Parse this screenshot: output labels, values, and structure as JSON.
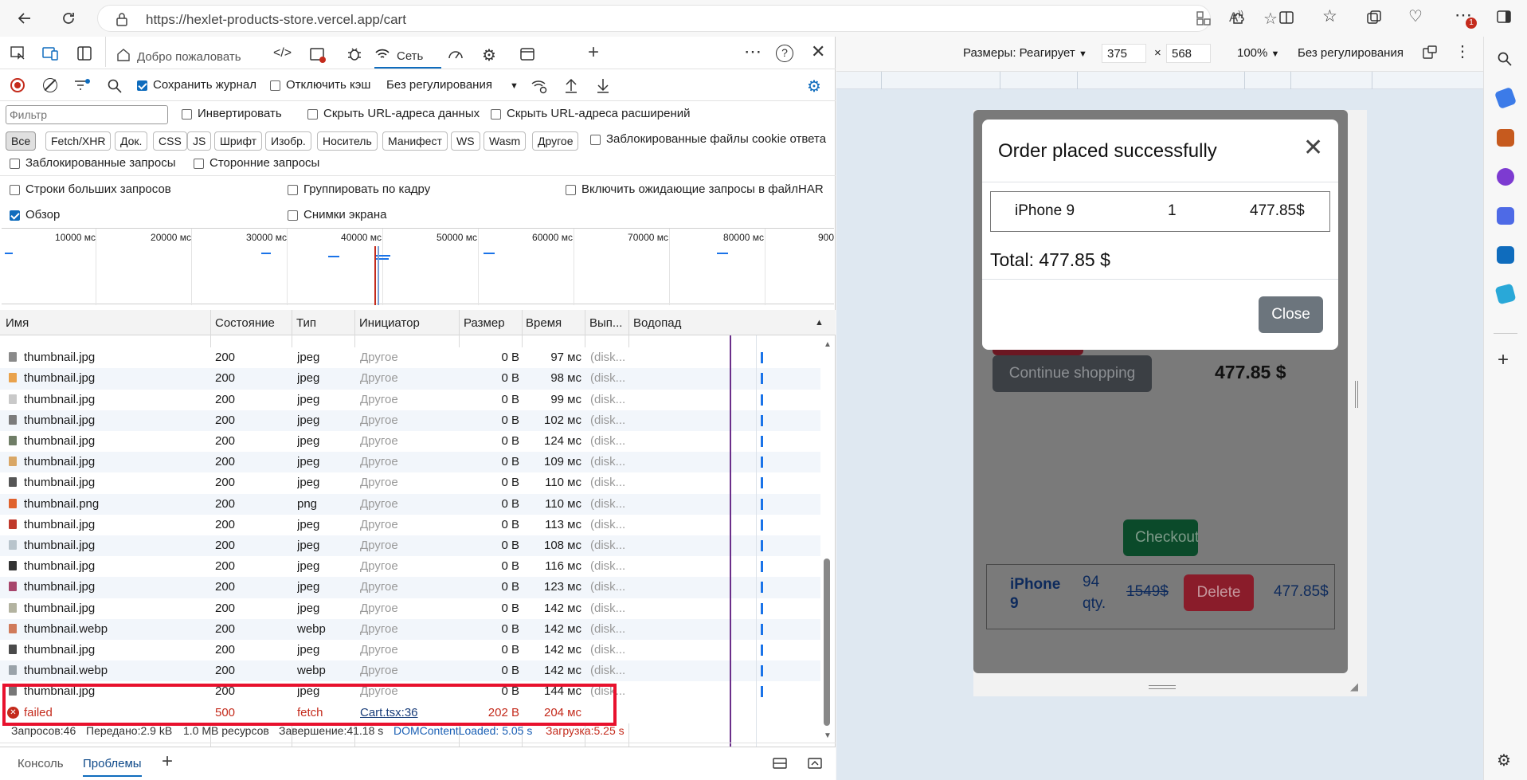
{
  "browser": {
    "url": "https://hexlet-products-store.vercel.app/cart"
  },
  "devtools": {
    "tabs": {
      "welcome": "Добро пожаловать",
      "network": "Сеть"
    },
    "toolbar": {
      "preserve_log": "Сохранить журнал",
      "disable_cache": "Отключить кэш",
      "throttling": "Без регулирования"
    },
    "filter": {
      "placeholder": "Фильтр",
      "invert": "Инвертировать",
      "hide_data_urls": "Скрыть URL-адреса данных",
      "hide_ext_urls": "Скрыть URL-адреса расширений",
      "blocked_cookies": "Заблокированные файлы cookie ответа",
      "blocked_requests": "Заблокированные запросы",
      "third_party": "Сторонние запросы"
    },
    "type_chips": [
      "Все",
      "Fetch/XHR",
      "Док.",
      "CSS",
      "JS",
      "Шрифт",
      "Изобр.",
      "Носитель",
      "Манифест",
      "WS",
      "Wasm",
      "Другое"
    ],
    "options": {
      "big_rows": "Строки больших запросов",
      "group_by_frame": "Группировать по кадру",
      "include_pending": "Включить ожидающие запросы в файлHAR",
      "overview": "Обзор",
      "screenshots": "Снимки экрана"
    },
    "overview_ticks": [
      "10000 мс",
      "20000 мс",
      "30000 мс",
      "40000 мс",
      "50000 мс",
      "60000 мс",
      "70000 мс",
      "80000 мс",
      "900"
    ],
    "columns": [
      "Имя",
      "Состояние",
      "Тип",
      "Инициатор",
      "Размер",
      "Время",
      "Вып...",
      "Водопад"
    ],
    "rows": [
      {
        "name": "thumbnail.jpg",
        "status": "200",
        "type": "jpeg",
        "initiator": "Другое",
        "size": "0 B",
        "time": "97 мс",
        "fulfilled": "(disk...",
        "icon_color": "#8a8a8a"
      },
      {
        "name": "thumbnail.jpg",
        "status": "200",
        "type": "jpeg",
        "initiator": "Другое",
        "size": "0 B",
        "time": "98 мс",
        "fulfilled": "(disk...",
        "icon_color": "#e9a24c"
      },
      {
        "name": "thumbnail.jpg",
        "status": "200",
        "type": "jpeg",
        "initiator": "Другое",
        "size": "0 B",
        "time": "99 мс",
        "fulfilled": "(disk...",
        "icon_color": "#c9c9c9"
      },
      {
        "name": "thumbnail.jpg",
        "status": "200",
        "type": "jpeg",
        "initiator": "Другое",
        "size": "0 B",
        "time": "102 мс",
        "fulfilled": "(disk...",
        "icon_color": "#7c7c7c"
      },
      {
        "name": "thumbnail.jpg",
        "status": "200",
        "type": "jpeg",
        "initiator": "Другое",
        "size": "0 B",
        "time": "124 мс",
        "fulfilled": "(disk...",
        "icon_color": "#6f7d66"
      },
      {
        "name": "thumbnail.jpg",
        "status": "200",
        "type": "jpeg",
        "initiator": "Другое",
        "size": "0 B",
        "time": "109 мс",
        "fulfilled": "(disk...",
        "icon_color": "#d9a766"
      },
      {
        "name": "thumbnail.jpg",
        "status": "200",
        "type": "jpeg",
        "initiator": "Другое",
        "size": "0 B",
        "time": "110 мс",
        "fulfilled": "(disk...",
        "icon_color": "#555555"
      },
      {
        "name": "thumbnail.png",
        "status": "200",
        "type": "png",
        "initiator": "Другое",
        "size": "0 B",
        "time": "110 мс",
        "fulfilled": "(disk...",
        "icon_color": "#e0622d"
      },
      {
        "name": "thumbnail.jpg",
        "status": "200",
        "type": "jpeg",
        "initiator": "Другое",
        "size": "0 B",
        "time": "113 мс",
        "fulfilled": "(disk...",
        "icon_color": "#c0392b"
      },
      {
        "name": "thumbnail.jpg",
        "status": "200",
        "type": "jpeg",
        "initiator": "Другое",
        "size": "0 B",
        "time": "108 мс",
        "fulfilled": "(disk...",
        "icon_color": "#b8c4cc"
      },
      {
        "name": "thumbnail.jpg",
        "status": "200",
        "type": "jpeg",
        "initiator": "Другое",
        "size": "0 B",
        "time": "116 мс",
        "fulfilled": "(disk...",
        "icon_color": "#333333"
      },
      {
        "name": "thumbnail.jpg",
        "status": "200",
        "type": "jpeg",
        "initiator": "Другое",
        "size": "0 B",
        "time": "123 мс",
        "fulfilled": "(disk...",
        "icon_color": "#a7456b"
      },
      {
        "name": "thumbnail.jpg",
        "status": "200",
        "type": "jpeg",
        "initiator": "Другое",
        "size": "0 B",
        "time": "142 мс",
        "fulfilled": "(disk...",
        "icon_color": "#b3b3a0"
      },
      {
        "name": "thumbnail.webp",
        "status": "200",
        "type": "webp",
        "initiator": "Другое",
        "size": "0 B",
        "time": "142 мс",
        "fulfilled": "(disk...",
        "icon_color": "#d07a5a"
      },
      {
        "name": "thumbnail.jpg",
        "status": "200",
        "type": "jpeg",
        "initiator": "Другое",
        "size": "0 B",
        "time": "142 мс",
        "fulfilled": "(disk...",
        "icon_color": "#4a4a4a"
      },
      {
        "name": "thumbnail.webp",
        "status": "200",
        "type": "webp",
        "initiator": "Другое",
        "size": "0 B",
        "time": "142 мс",
        "fulfilled": "(disk...",
        "icon_color": "#9aa3aa"
      },
      {
        "name": "thumbnail.jpg",
        "status": "200",
        "type": "jpeg",
        "initiator": "Другое",
        "size": "0 B",
        "time": "144 мс",
        "fulfilled": "(disk...",
        "icon_color": "#777777"
      }
    ],
    "failed_row": {
      "name": "failed",
      "status": "500",
      "type": "fetch",
      "initiator": "Cart.tsx:36",
      "size": "202 B",
      "time": "204 мс"
    },
    "status_bar": {
      "requests": "Запросов:46",
      "transferred": "Передано:2.9 kB",
      "resources": "1.0 MB ресурсов",
      "finish": "Завершение:41.18 s",
      "dcl": "DOMContentLoaded: 5.05 s",
      "load": "Загрузка:5.25 s"
    },
    "drawer_tabs": {
      "console": "Консоль",
      "issues": "Проблемы"
    }
  },
  "device_toolbar": {
    "dimensions_label": "Размеры: Реагирует",
    "width": "375",
    "height": "568",
    "times": "×",
    "zoom": "100%",
    "throttle": "Без регулирования"
  },
  "page": {
    "modal": {
      "title": "Order placed successfully",
      "item_name": "iPhone 9",
      "item_qty": "1",
      "item_price": "477.85$",
      "total": "Total: 477.85 $",
      "close_button": "Close"
    },
    "background": {
      "continue_shopping": "Continue shopping",
      "cart_total": "477.85 $",
      "checkout": "Checkout",
      "cart_item_name": "iPhone 9",
      "cart_item_qty": "94 qty.",
      "cart_item_old_price": "1549$",
      "delete_button": "Delete",
      "cart_item_price": "477.85$"
    }
  },
  "colors": {
    "accent_blue": "#0f6cbd",
    "error_red": "#c42b1c",
    "highlight_red": "#e8112d",
    "checkout_green": "#0b4a2a",
    "delete_red": "#8a1c2a",
    "close_gray": "#6c757d"
  }
}
